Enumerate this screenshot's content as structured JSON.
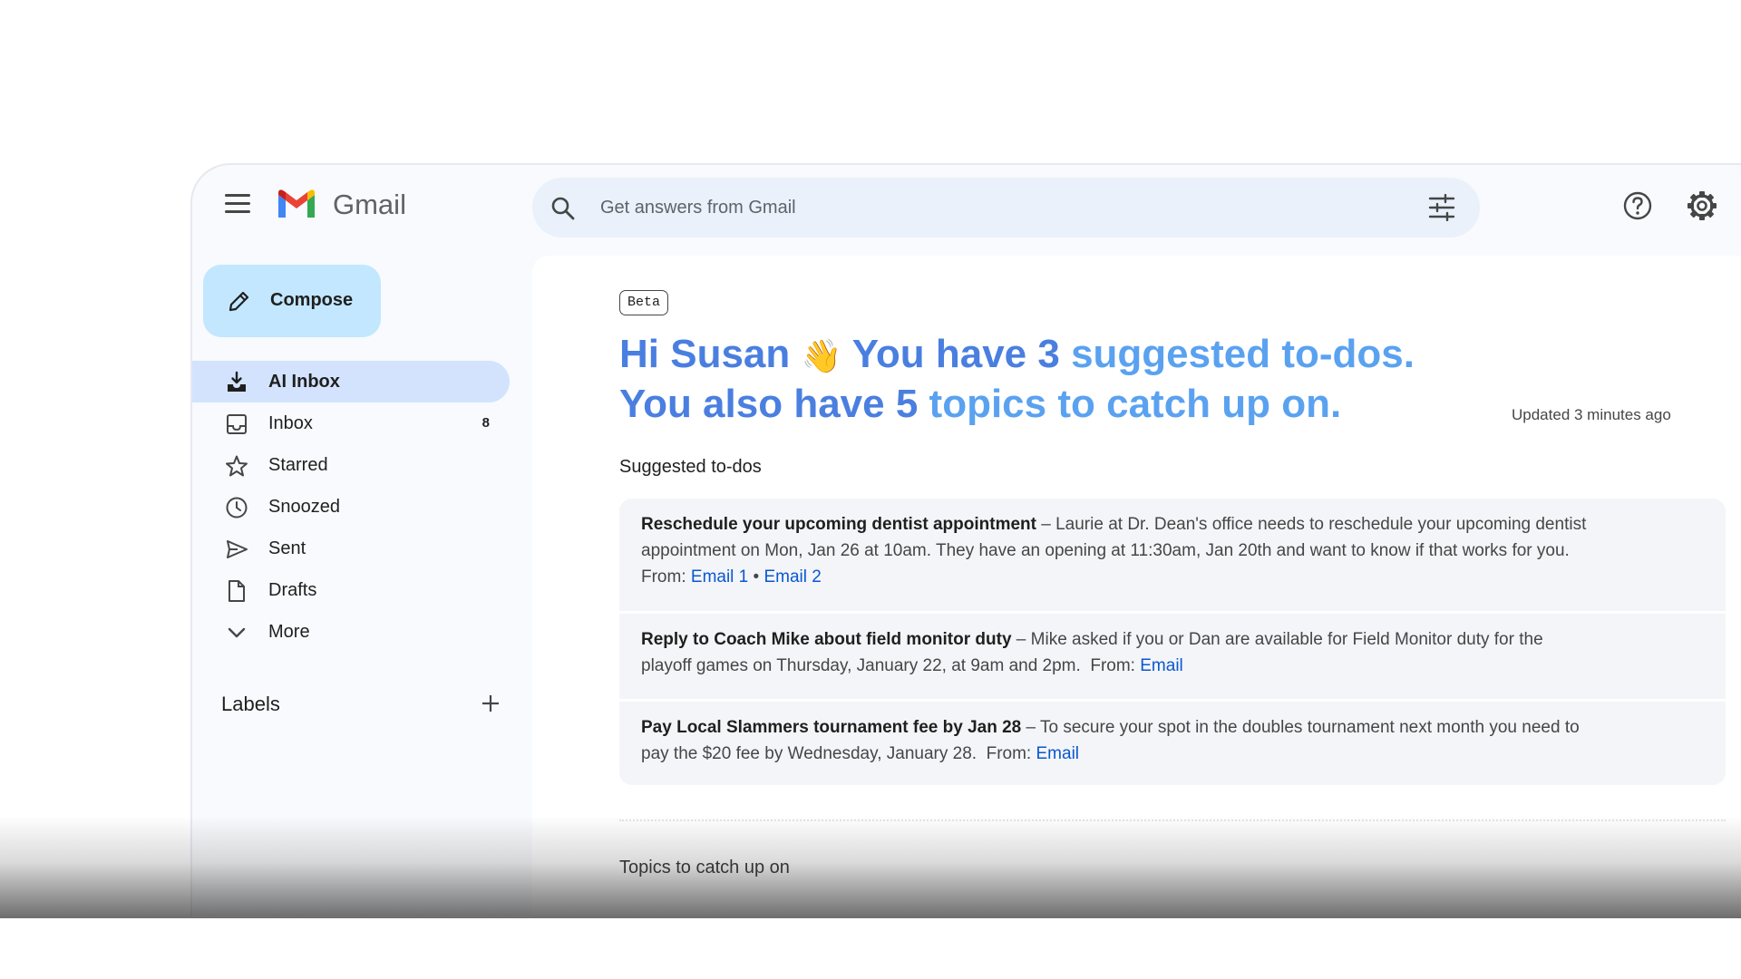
{
  "app": {
    "brand": "Gmail"
  },
  "search": {
    "placeholder": "Get answers from Gmail"
  },
  "compose": {
    "label": "Compose"
  },
  "sidebar": {
    "items": [
      {
        "label": "AI Inbox",
        "icon": "ai-inbox-icon",
        "active": true
      },
      {
        "label": "Inbox",
        "icon": "inbox-icon",
        "count": "8"
      },
      {
        "label": "Starred",
        "icon": "star-icon"
      },
      {
        "label": "Snoozed",
        "icon": "clock-icon"
      },
      {
        "label": "Sent",
        "icon": "send-icon"
      },
      {
        "label": "Drafts",
        "icon": "draft-icon"
      },
      {
        "label": "More",
        "icon": "chevron-down-icon"
      }
    ],
    "labels_title": "Labels"
  },
  "main": {
    "badge": "Beta",
    "greeting": {
      "line1_a": "Hi Susan",
      "wave": "👋",
      "line1_b": "You have 3",
      "line1_c": "suggested to-dos.",
      "line2_a": "You also have 5",
      "line2_b": "topics to catch up on."
    },
    "updated": "Updated 3 minutes ago",
    "todos_title": "Suggested to-dos",
    "todos": [
      {
        "title": "Reschedule your upcoming dentist appointment",
        "body": "Laurie at Dr. Dean's office needs to reschedule your upcoming dentist appointment on Mon, Jan 26 at 10am. They have an opening at 11:30am, Jan 20th and want to know if that works for you.",
        "from_label": "From:",
        "links": [
          "Email 1",
          "Email 2"
        ]
      },
      {
        "title": "Reply to Coach Mike about field monitor duty",
        "body": "Mike asked if you or Dan are available for Field Monitor duty for the playoff games on Thursday, January 22, at 9am and 2pm.",
        "from_label": "From:",
        "links": [
          "Email"
        ]
      },
      {
        "title": "Pay Local Slammers tournament fee by Jan 28",
        "body": "To secure your spot in the doubles tournament next month you need to pay the $20 fee by Wednesday, January 28.",
        "from_label": "From:",
        "links": [
          "Email"
        ]
      }
    ],
    "topics_title": "Topics to catch up on"
  },
  "colors": {
    "accent_dark": "#4a7fe0",
    "accent_light": "#5aa2f0",
    "compose_bg": "#c2e7ff",
    "active_nav_bg": "#d3e3fd",
    "link": "#0b57d0"
  }
}
